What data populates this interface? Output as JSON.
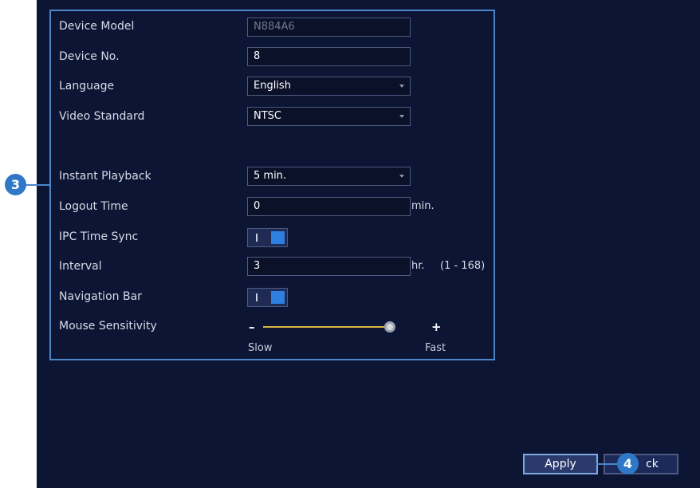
{
  "settings": {
    "device_model": {
      "label": "Device Model",
      "value": "N884A6"
    },
    "device_no": {
      "label": "Device No.",
      "value": "8"
    },
    "language": {
      "label": "Language",
      "value": "English"
    },
    "video_standard": {
      "label": "Video Standard",
      "value": "NTSC"
    },
    "instant_playback": {
      "label": "Instant Playback",
      "value": "5 min."
    },
    "logout_time": {
      "label": "Logout Time",
      "value": "0",
      "unit": "min."
    },
    "ipc_time_sync": {
      "label": "IPC Time Sync",
      "state": "on"
    },
    "interval": {
      "label": "Interval",
      "value": "3",
      "unit": "hr.",
      "range": "(1 - 168)"
    },
    "navigation_bar": {
      "label": "Navigation Bar",
      "state": "on"
    },
    "mouse_sensitivity": {
      "label": "Mouse Sensitivity",
      "min_sign": "–",
      "max_sign": "+",
      "min_label": "Slow",
      "max_label": "Fast",
      "level": 1.0
    }
  },
  "callouts": {
    "settings_marker": "3",
    "apply_marker": "4"
  },
  "buttons": {
    "apply": "Apply",
    "back": "ck"
  },
  "colors": {
    "background": "#0d1535",
    "accent": "#2d7fe0",
    "border": "#4b86c9",
    "slider": "#d8b743"
  }
}
